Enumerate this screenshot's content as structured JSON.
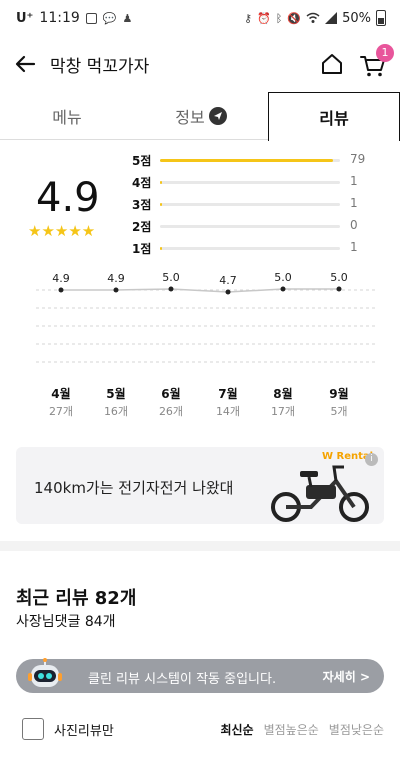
{
  "status_bar": {
    "carrier": "U⁺",
    "time": "11:19",
    "battery": "50%"
  },
  "app_bar": {
    "title": "막창 먹꼬가자",
    "cart_count": "1"
  },
  "tabs": [
    {
      "label": "메뉴",
      "active": false
    },
    {
      "label": "정보",
      "active": false
    },
    {
      "label": "리뷰",
      "active": true
    }
  ],
  "rating": {
    "average": "4.9",
    "stars": "★★★★★"
  },
  "distribution": [
    {
      "label": "5점",
      "count": 79,
      "fraction": 0.96
    },
    {
      "label": "4점",
      "count": 1,
      "fraction": 0.012
    },
    {
      "label": "3점",
      "count": 1,
      "fraction": 0.012
    },
    {
      "label": "2점",
      "count": 0,
      "fraction": 0.0
    },
    {
      "label": "1점",
      "count": 1,
      "fraction": 0.012
    }
  ],
  "chart_data": {
    "type": "line",
    "categories": [
      "4월",
      "5월",
      "6월",
      "7월",
      "8월",
      "9월"
    ],
    "counts": [
      "27개",
      "16개",
      "26개",
      "14개",
      "17개",
      "5개"
    ],
    "values": [
      4.9,
      4.9,
      5.0,
      4.7,
      5.0,
      5.0
    ],
    "value_labels": [
      "4.9",
      "4.9",
      "5.0",
      "4.7",
      "5.0",
      "5.0"
    ],
    "grid": true
  },
  "ad": {
    "text": "140km가는 전기자전거 나왔대",
    "brand": "Rental",
    "info": "i"
  },
  "reviews": {
    "recent_title": "최근 리뷰 82개",
    "owner_comments": "사장님댓글 84개"
  },
  "clean_review": {
    "text": "클린 리뷰 시스템이 작동 중입니다.",
    "more": "자세히 >"
  },
  "filters": {
    "photo_only": "사진리뷰만",
    "sort": [
      {
        "label": "최신순",
        "active": true
      },
      {
        "label": "별점높은순",
        "active": false
      },
      {
        "label": "별점낮은순",
        "active": false
      }
    ]
  },
  "colors": {
    "accent_yellow": "#f5c518",
    "badge_pink": "#e8559b"
  }
}
